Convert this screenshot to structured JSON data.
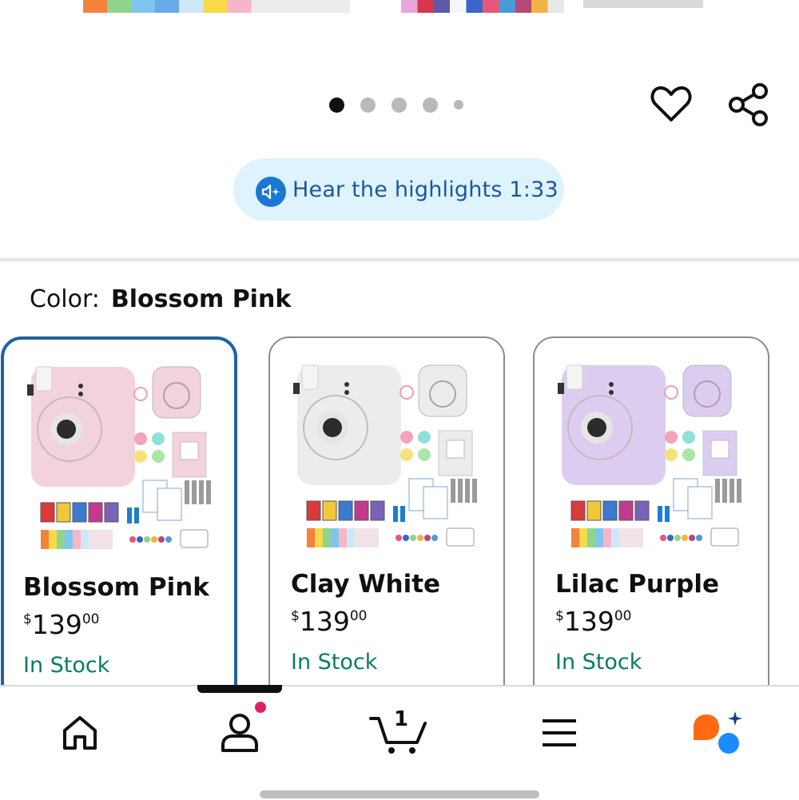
{
  "gallery": {
    "page_count": 5,
    "active_index": 0
  },
  "actions": {
    "favorite_icon": "heart-icon",
    "share_icon": "share-icon"
  },
  "audio": {
    "label": "Hear the highlights 1:33",
    "icon": "audio-sparkle-icon"
  },
  "color_selector": {
    "label": "Color:",
    "selected": "Blossom Pink"
  },
  "variants": [
    {
      "name": "Blossom Pink",
      "price_symbol": "$",
      "price_whole": "139",
      "price_fraction": "00",
      "stock": "In Stock",
      "selected": true,
      "camera_color": "#f2d2db"
    },
    {
      "name": "Clay White",
      "price_symbol": "$",
      "price_whole": "139",
      "price_fraction": "00",
      "stock": "In Stock",
      "selected": false,
      "camera_color": "#ececee"
    },
    {
      "name": "Lilac Purple",
      "price_symbol": "$",
      "price_whole": "139",
      "price_fraction": "00",
      "stock": "In Stock",
      "selected": false,
      "camera_color": "#dccdf0"
    }
  ],
  "bottom_nav": {
    "items": [
      "home-icon",
      "account-icon",
      "cart-icon",
      "menu-icon",
      "rufus-icon"
    ],
    "active": "account-icon",
    "cart_count": "1"
  },
  "colors": {
    "accent_blue": "#2162a1",
    "stock_green": "#067d62",
    "pill_bg": "#dff3fd",
    "notification": "#e3205f"
  }
}
